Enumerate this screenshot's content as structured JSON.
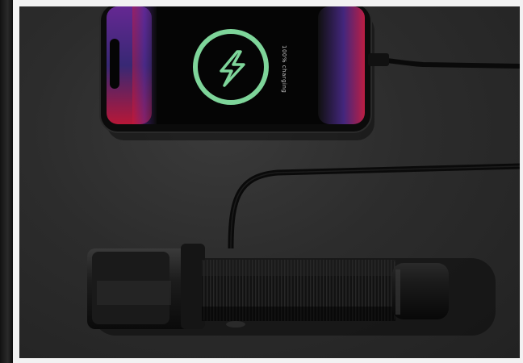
{
  "photo": {
    "phone_status_text": "100% charging",
    "icon": "lightning-bolt-icon",
    "accent_color": "#7ed59a",
    "screen_colors": [
      "#c02040",
      "#5030a0",
      "#1a1030"
    ]
  }
}
